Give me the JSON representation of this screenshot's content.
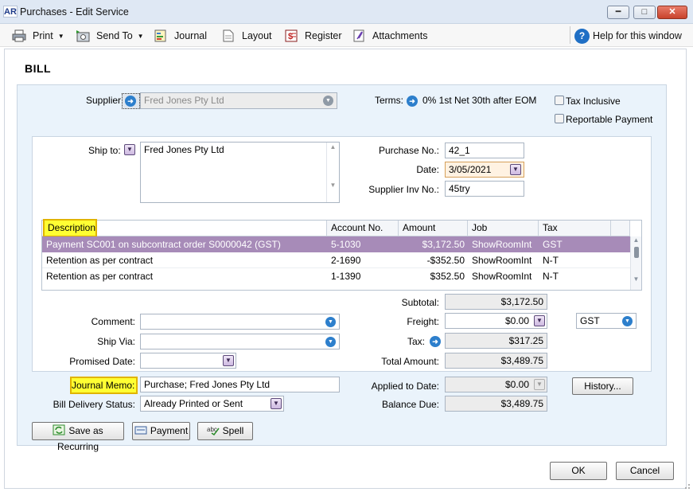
{
  "window": {
    "logo": "AR",
    "title": "Purchases - Edit Service",
    "minimize_glyph": "━",
    "maximize_glyph": "□",
    "close_glyph": "✕"
  },
  "toolbar": {
    "print_label": "Print",
    "sendto_label": "Send To",
    "journal_label": "Journal",
    "layout_label": "Layout",
    "register_label": "Register",
    "attachments_label": "Attachments",
    "help_label": "Help for this window",
    "help_glyph": "?",
    "caret": "▼"
  },
  "form": {
    "title": "BILL",
    "supplier_label": "Supplier:",
    "supplier_value": "Fred Jones Pty Ltd",
    "terms_label": "Terms:",
    "terms_value": "0% 1st Net 30th after EOM",
    "tax_inclusive_label": "Tax Inclusive",
    "reportable_payment_label": "Reportable Payment",
    "ship_to_label": "Ship to:",
    "ship_to_value": "Fred Jones Pty Ltd",
    "purchase_no_label": "Purchase No.:",
    "purchase_no_value": "42_1",
    "date_label": "Date:",
    "date_value": "3/05/2021",
    "supplier_inv_label": "Supplier Inv No.:",
    "supplier_inv_value": "45try"
  },
  "grid": {
    "headers": [
      "Description",
      "Account No.",
      "Amount",
      "Job",
      "Tax"
    ],
    "rows": [
      {
        "description": "Payment SC001 on subcontract order S0000042 (GST)",
        "account": "5-1030",
        "amount": "$3,172.50",
        "job": "ShowRoomInt",
        "tax": "GST"
      },
      {
        "description": "Retention as per contract",
        "account": "2-1690",
        "amount": "-$352.50",
        "job": "ShowRoomInt",
        "tax": "N-T"
      },
      {
        "description": "Retention as per contract",
        "account": "1-1390",
        "amount": "$352.50",
        "job": "ShowRoomInt",
        "tax": "N-T"
      }
    ]
  },
  "lower": {
    "comment_label": "Comment:",
    "ship_via_label": "Ship Via:",
    "promised_date_label": "Promised Date:",
    "journal_memo_label": "Journal Memo:",
    "journal_memo_value": "Purchase; Fred Jones Pty Ltd",
    "bill_delivery_label": "Bill Delivery Status:",
    "bill_delivery_value": "Already Printed or Sent"
  },
  "totals": {
    "subtotal_label": "Subtotal:",
    "subtotal_value": "$3,172.50",
    "freight_label": "Freight:",
    "freight_value": "$0.00",
    "freight_tax_code": "GST",
    "tax_label": "Tax:",
    "tax_value": "$317.25",
    "total_label": "Total Amount:",
    "total_value": "$3,489.75",
    "applied_label": "Applied to Date:",
    "applied_value": "$0.00",
    "balance_label": "Balance Due:",
    "balance_value": "$3,489.75",
    "history_label": "History..."
  },
  "buttons": {
    "save_recurring": "Save as Recurring",
    "payment": "Payment",
    "spell": "Spell",
    "ok": "OK",
    "cancel": "Cancel"
  }
}
